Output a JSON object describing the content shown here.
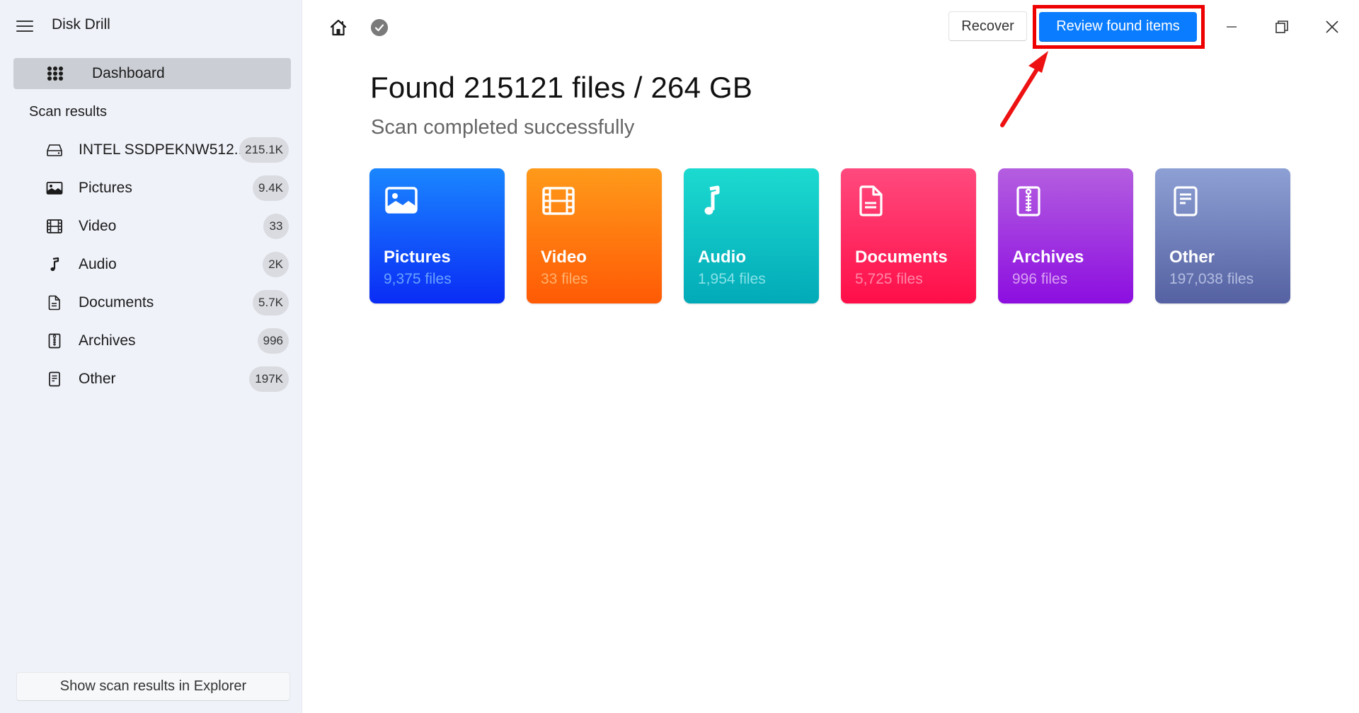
{
  "app": {
    "title": "Disk Drill"
  },
  "sidebar": {
    "dashboard_label": "Dashboard",
    "section_label": "Scan results",
    "items": [
      {
        "label": "INTEL SSDPEKNW512...",
        "badge": "215.1K",
        "icon": "drive-icon"
      },
      {
        "label": "Pictures",
        "badge": "9.4K",
        "icon": "picture-icon"
      },
      {
        "label": "Video",
        "badge": "33",
        "icon": "film-icon"
      },
      {
        "label": "Audio",
        "badge": "2K",
        "icon": "music-note-icon"
      },
      {
        "label": "Documents",
        "badge": "5.7K",
        "icon": "document-icon"
      },
      {
        "label": "Archives",
        "badge": "996",
        "icon": "archive-zip-icon"
      },
      {
        "label": "Other",
        "badge": "197K",
        "icon": "other-file-icon"
      }
    ],
    "explorer_button": "Show scan results in Explorer"
  },
  "toolbar": {
    "recover_label": "Recover",
    "review_label": "Review found items",
    "highlight_color": "#ee0000",
    "accent_color": "#0a7cff"
  },
  "main": {
    "heading": "Found 215121 files / 264 GB",
    "subheading": "Scan completed successfully",
    "cards": [
      {
        "title": "Pictures",
        "count": "9,375 files",
        "color": "#0a5cff"
      },
      {
        "title": "Video",
        "count": "33 files",
        "color": "#ff7a0f"
      },
      {
        "title": "Audio",
        "count": "1,954 files",
        "color": "#10c2c4"
      },
      {
        "title": "Documents",
        "count": "5,725 files",
        "color": "#ff2c62"
      },
      {
        "title": "Archives",
        "count": "996 files",
        "color": "#a236e0"
      },
      {
        "title": "Other",
        "count": "197,038 files",
        "color": "#717dbb"
      }
    ]
  }
}
